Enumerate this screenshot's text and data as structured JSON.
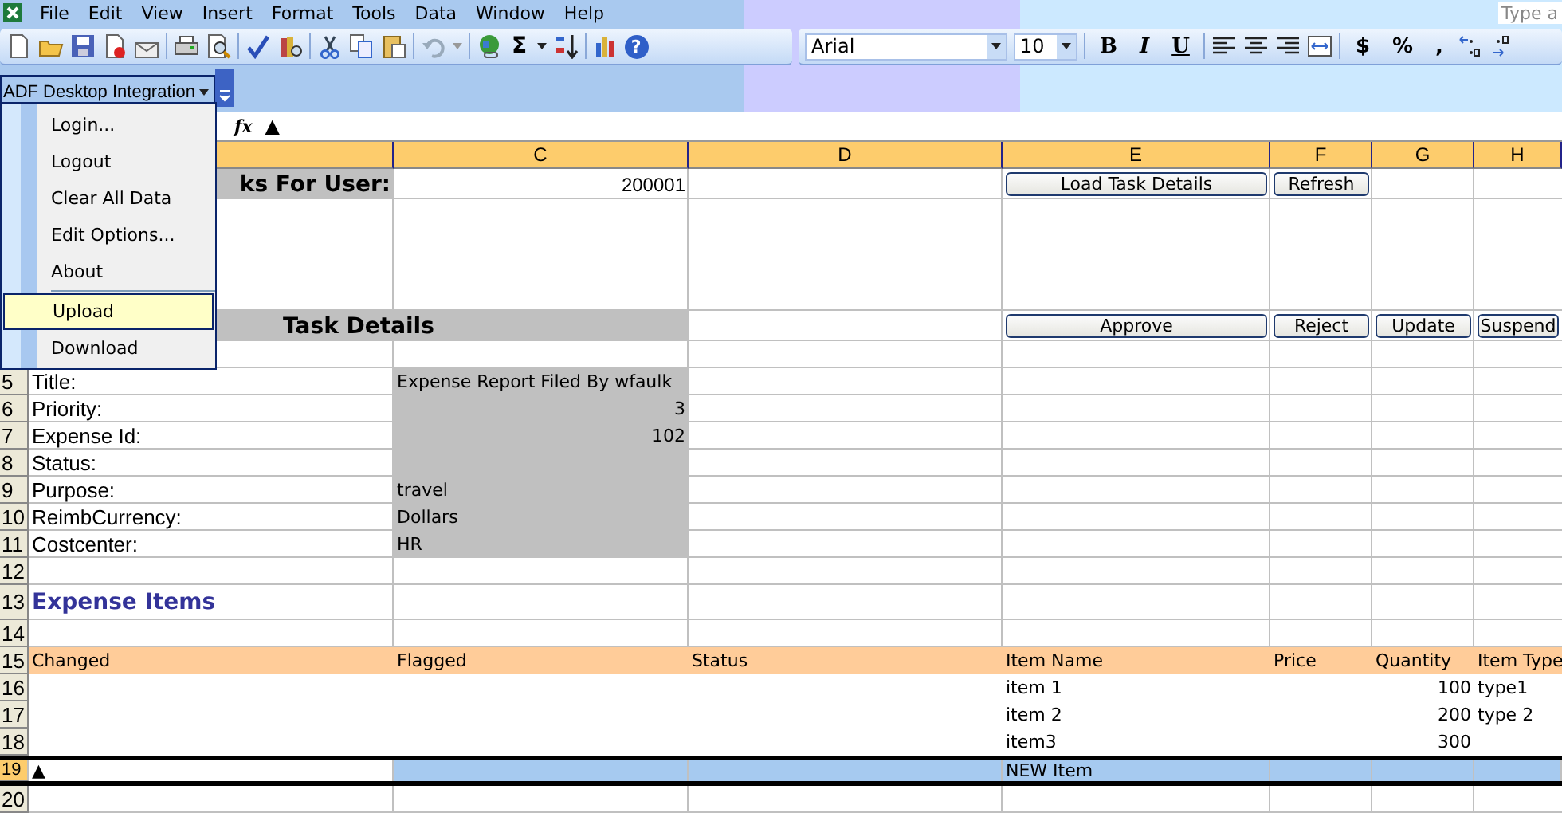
{
  "menu_bar": {
    "items": [
      "File",
      "Edit",
      "View",
      "Insert",
      "Format",
      "Tools",
      "Data",
      "Window",
      "Help"
    ],
    "help_placeholder": "Type a"
  },
  "standard_toolbar": {
    "autosum": "Σ",
    "help": "?"
  },
  "format_toolbar": {
    "font": "Arial",
    "size": "10",
    "buttons": [
      {
        "label": "B",
        "kind": "bold"
      },
      {
        "label": "I",
        "kind": "italic"
      },
      {
        "label": "U",
        "kind": "underline"
      },
      {
        "label": "$",
        "kind": "plain"
      },
      {
        "label": "%",
        "kind": "plain"
      },
      {
        "label": ",",
        "kind": "plain"
      }
    ]
  },
  "adf_toolbar": {
    "label": "ADF Desktop Integration"
  },
  "adf_menu": {
    "groups": [
      [
        {
          "label": "Login...",
          "selected": false
        },
        {
          "label": "Logout",
          "selected": false
        },
        {
          "label": "Clear All Data",
          "selected": false
        },
        {
          "label": "Edit Options...",
          "selected": false
        },
        {
          "label": "About",
          "selected": false
        }
      ],
      [
        {
          "label": "Upload",
          "selected": true
        },
        {
          "label": "Download",
          "selected": false
        }
      ]
    ]
  },
  "formula_bar": {
    "function_label": "fx",
    "value": "▲"
  },
  "sheet": {
    "columns": [
      "C",
      "D",
      "E",
      "F",
      "G",
      "H"
    ],
    "user_label": "ks For User:",
    "user_id": "200001",
    "top_buttons": [
      "Load Task Details",
      "Refresh"
    ],
    "section_title": "Task Details",
    "action_buttons": [
      "Approve",
      "Reject",
      "Update",
      "Suspend"
    ],
    "fields": [
      {
        "row": "5",
        "label": "Title:",
        "value": "Expense Report Filed By wfaulk",
        "kind": "text"
      },
      {
        "row": "6",
        "label": "Priority:",
        "value": "3",
        "kind": "number"
      },
      {
        "row": "7",
        "label": "Expense Id:",
        "value": "102",
        "kind": "number"
      },
      {
        "row": "8",
        "label": "Status:",
        "kind": "text"
      },
      {
        "row": "9",
        "label": "Purpose:",
        "value": "travel",
        "kind": "text"
      },
      {
        "row": "10",
        "label": "ReimbCurrency:",
        "value": "Dollars",
        "kind": "text"
      },
      {
        "row": "11",
        "label": "Costcenter:",
        "value": "HR",
        "kind": "text"
      }
    ],
    "blank_rows": [
      "12",
      "14"
    ],
    "expense_title": {
      "row": "13",
      "text": "Expense Items"
    },
    "items_table": {
      "row": "15",
      "columns": [
        "Changed",
        "Flagged",
        "Status",
        "Item Name",
        "Price",
        "Quantity",
        "Item Type"
      ],
      "rows": [
        {
          "row": "16",
          "item_name": "item 1",
          "quantity": "100",
          "item_type": "type1",
          "selected": false
        },
        {
          "row": "17",
          "item_name": "item 2",
          "quantity": "200",
          "item_type": "type 2",
          "selected": false
        },
        {
          "row": "18",
          "item_name": "item3",
          "quantity": "300",
          "selected": false
        },
        {
          "row": "19",
          "changed": "▲",
          "item_name": "NEW Item",
          "selected": true
        }
      ]
    },
    "trailing_rows": [
      "20"
    ]
  }
}
